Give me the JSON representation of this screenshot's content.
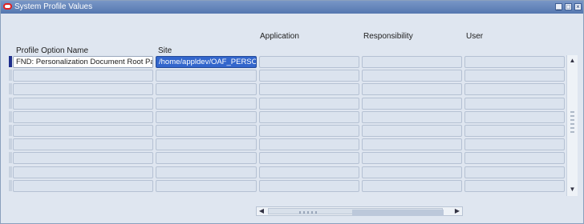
{
  "window": {
    "title": "System Profile Values"
  },
  "columns": {
    "profile_option_name": "Profile Option Name",
    "site": "Site",
    "application": "Application",
    "responsibility": "Responsibility",
    "user": "User"
  },
  "rows": [
    {
      "profile_option_name": "FND: Personalization Document Root Pa",
      "site": "/home/appldev/OAF_PERSO",
      "application": "",
      "responsibility": "",
      "user": ""
    },
    {
      "profile_option_name": "",
      "site": "",
      "application": "",
      "responsibility": "",
      "user": ""
    },
    {
      "profile_option_name": "",
      "site": "",
      "application": "",
      "responsibility": "",
      "user": ""
    },
    {
      "profile_option_name": "",
      "site": "",
      "application": "",
      "responsibility": "",
      "user": ""
    },
    {
      "profile_option_name": "",
      "site": "",
      "application": "",
      "responsibility": "",
      "user": ""
    },
    {
      "profile_option_name": "",
      "site": "",
      "application": "",
      "responsibility": "",
      "user": ""
    },
    {
      "profile_option_name": "",
      "site": "",
      "application": "",
      "responsibility": "",
      "user": ""
    },
    {
      "profile_option_name": "",
      "site": "",
      "application": "",
      "responsibility": "",
      "user": ""
    },
    {
      "profile_option_name": "",
      "site": "",
      "application": "",
      "responsibility": "",
      "user": ""
    },
    {
      "profile_option_name": "",
      "site": "",
      "application": "",
      "responsibility": "",
      "user": ""
    }
  ],
  "icons": {
    "app": "oracle-logo-icon",
    "minimize": "minimize-icon",
    "maximize": "maximize-icon",
    "close": "close-icon"
  },
  "colors": {
    "titlebar": "#5577b0",
    "selection": "#3366cc",
    "row_indicator_active": "#1e2e8c"
  }
}
